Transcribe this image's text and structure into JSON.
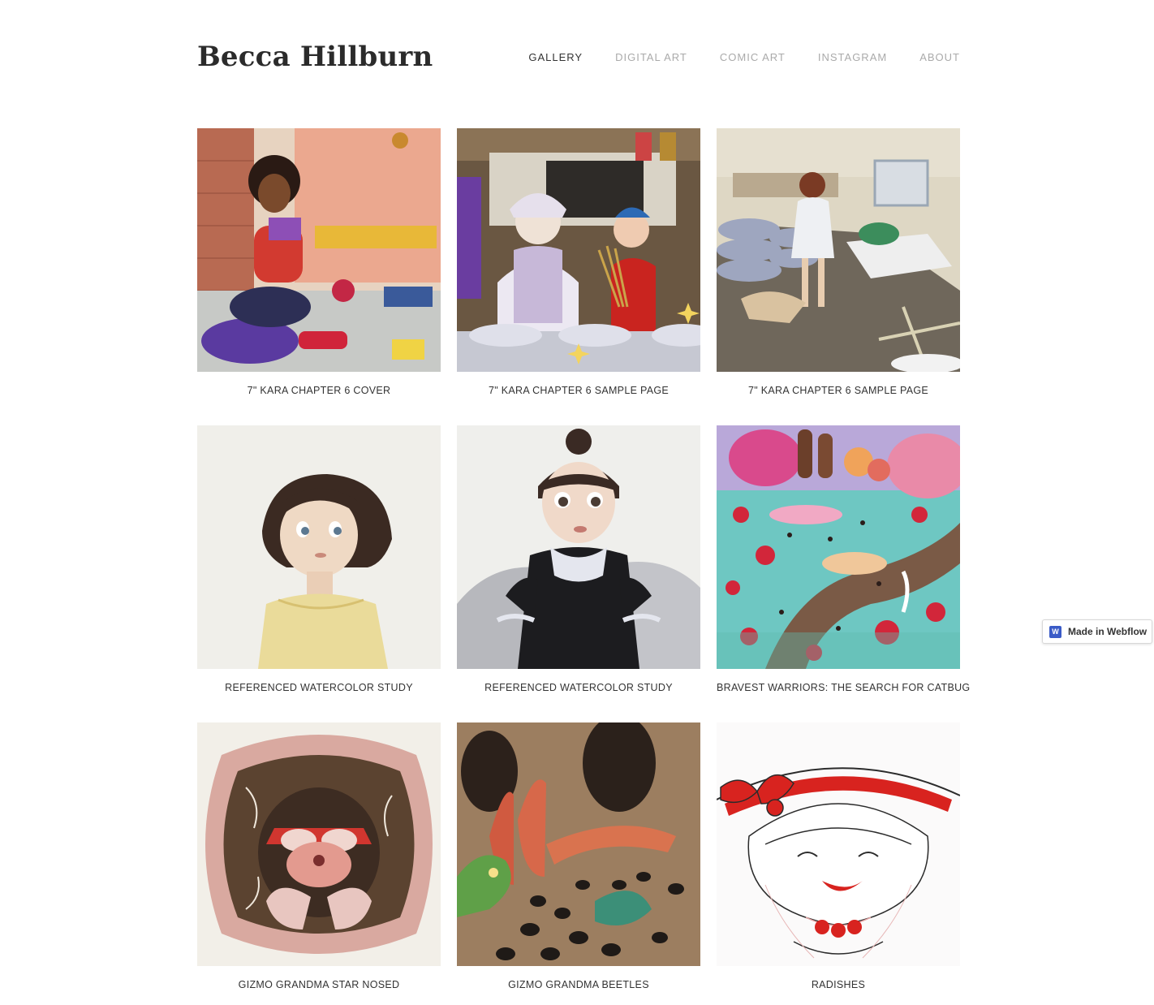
{
  "site": {
    "brand": "Becca Hillburn"
  },
  "nav": {
    "items": [
      {
        "label": "GALLERY"
      },
      {
        "label": "DIGITAL ART"
      },
      {
        "label": "COMIC ART"
      },
      {
        "label": "INSTAGRAM"
      },
      {
        "label": "ABOUT"
      }
    ]
  },
  "gallery": {
    "items": [
      {
        "caption": "7\" KARA CHAPTER 6 COVER"
      },
      {
        "caption": "7\" KARA CHAPTER 6 SAMPLE PAGE"
      },
      {
        "caption": "7\" KARA CHAPTER 6 SAMPLE PAGE"
      },
      {
        "caption": "REFERENCED WATERCOLOR STUDY"
      },
      {
        "caption": "REFERENCED WATERCOLOR STUDY"
      },
      {
        "caption": "BRAVEST WARRIORS: THE SEARCH FOR CATBUG"
      },
      {
        "caption": "GIZMO GRANDMA STAR NOSED"
      },
      {
        "caption": "GIZMO GRANDMA BEETLES"
      },
      {
        "caption": "RADISHES"
      }
    ]
  },
  "badge": {
    "label": "Made in Webflow",
    "logo": "W"
  }
}
